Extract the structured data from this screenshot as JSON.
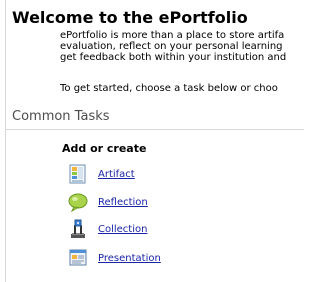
{
  "page": {
    "title": "Welcome to the ePortfolio",
    "intro_lines": [
      "ePortfolio is more than a place to store artifa",
      "evaluation, reflect on your personal learning",
      "get feedback both within your institution and"
    ],
    "call_to_action": "To get started, choose a task below or choo"
  },
  "common_tasks": {
    "title": "Common Tasks",
    "group_title": "Add or create",
    "items": [
      {
        "label": "Artifact",
        "icon": "artifact-icon"
      },
      {
        "label": "Reflection",
        "icon": "reflection-icon"
      },
      {
        "label": "Collection",
        "icon": "collection-icon"
      },
      {
        "label": "Presentation",
        "icon": "presentation-icon"
      }
    ]
  },
  "colors": {
    "link": "#1a24a8",
    "section_title": "#4d4d4d"
  }
}
